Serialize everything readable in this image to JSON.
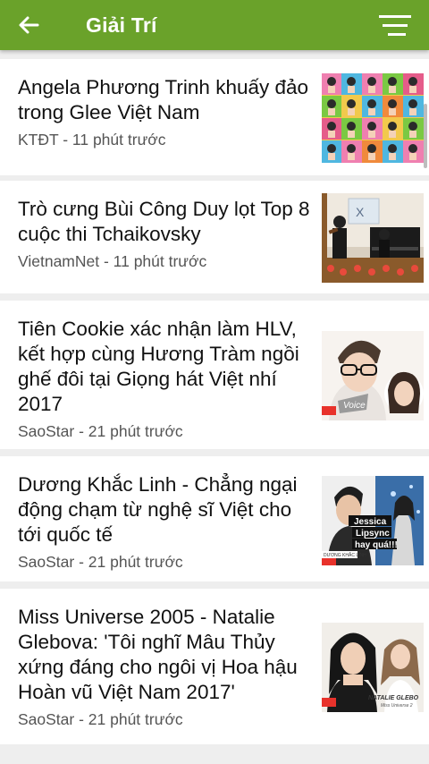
{
  "header": {
    "title": "Giải Trí",
    "back_icon": "arrow-left-icon",
    "menu_icon": "sort-menu-icon",
    "bar_color": "#6aa22a"
  },
  "articles": [
    {
      "title": "Angela Phương Trinh khuấy đảo trong Glee Việt Nam",
      "source": "KTĐT",
      "time": "11 phút trước",
      "meta": "KTĐT - 11 phút trước"
    },
    {
      "title": "Trò cưng Bùi Công Duy lọt Top 8 cuộc thi Tchaikovsky",
      "source": "VietnamNet",
      "time": "11 phút trước",
      "meta": "VietnamNet - 11 phút trước"
    },
    {
      "title": "Tiên Cookie xác nhận làm HLV, kết hợp cùng Hương Tràm ngồi ghế đôi tại Giọng hát Việt nhí 2017",
      "source": "SaoStar",
      "time": "21 phút trước",
      "meta": "SaoStar - 21 phút trước"
    },
    {
      "title": "Dương Khắc Linh - Chẳng ngại động chạm từ nghệ sĩ Việt cho tới quốc tế",
      "source": "SaoStar",
      "time": "21 phút trước",
      "meta": "SaoStar - 21 phút trước"
    },
    {
      "title": "Miss Universe 2005 - Natalie Glebova: 'Tôi nghĩ Mâu Thủy xứng đáng cho ngôi vị Hoa hậu Hoàn vũ Việt Nam 2017'",
      "source": "SaoStar",
      "time": "21 phút trước",
      "meta": "SaoStar - 21 phút trước"
    }
  ],
  "thumb_captions": {
    "voice_logo": "Voice",
    "sticker_line1": "Jessica",
    "sticker_line2": "Lipsync",
    "sticker_line3": "hay quá!!!",
    "name_tag": "DƯƠNG KHẮC LINH",
    "natalie_tag": "NATALIE GLEBO",
    "natalie_sub": "Miss Universe 2"
  }
}
